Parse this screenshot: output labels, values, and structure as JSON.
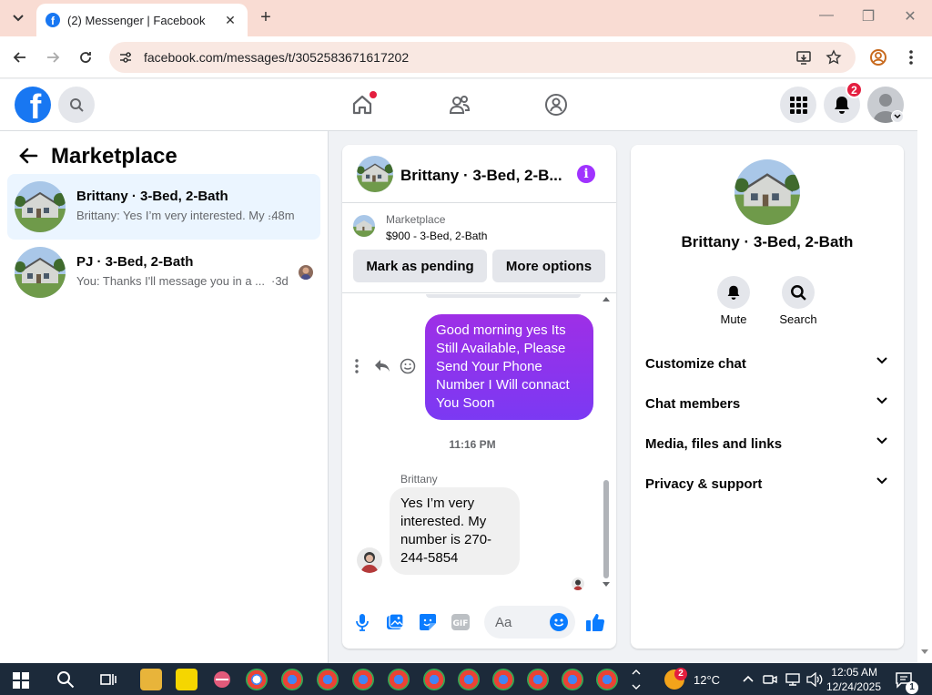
{
  "browser": {
    "tab_title": "(2) Messenger | Facebook",
    "url": "facebook.com/messages/t/3052583671617202",
    "new_tab_glyph": "+",
    "close_tab_glyph": "✕",
    "window_controls": [
      "—",
      "❐",
      "✕"
    ]
  },
  "fb_header": {
    "logo_letter": "f",
    "notifications_badge": "2",
    "brand_color": "#1877f2"
  },
  "left_pane": {
    "title": "Marketplace",
    "chats": [
      {
        "name": "Brittany · 3-Bed, 2-Bath",
        "preview": "Brittany: Yes I’m very interested. My ...",
        "time": "·48m",
        "active": true
      },
      {
        "name": "PJ · 3-Bed, 2-Bath",
        "preview": "You: Thanks I'll message you in a ...",
        "time": "·3d",
        "active": false
      }
    ]
  },
  "conversation": {
    "title": "Brittany · 3-Bed, 2-B...",
    "marketplace_label": "Marketplace",
    "listing": "$900 - 3-Bed, 2-Bath",
    "mark_pending_label": "Mark as pending",
    "more_options_label": "More options",
    "outgoing_message": "Good morning yes Its Still Available, Please Send Your Phone Number I Will connact You Soon",
    "timestamp": "11:16 PM",
    "sender_name": "Brittany",
    "incoming_message": "Yes I’m very interested. My number is 270-244-5854",
    "composer_placeholder": "Aa",
    "accent_color": "#a033ff"
  },
  "right_pane": {
    "name": "Brittany · 3-Bed, 2-Bath",
    "actions": [
      {
        "label": "Mute",
        "icon": "bell-icon"
      },
      {
        "label": "Search",
        "icon": "search-icon"
      }
    ],
    "sections": [
      "Customize chat",
      "Chat members",
      "Media, files and links",
      "Privacy & support"
    ]
  },
  "taskbar": {
    "weather_temp": "12°C",
    "weather_badge": "2",
    "time": "12:05 AM",
    "date": "12/24/2025",
    "notification_count": "1"
  }
}
